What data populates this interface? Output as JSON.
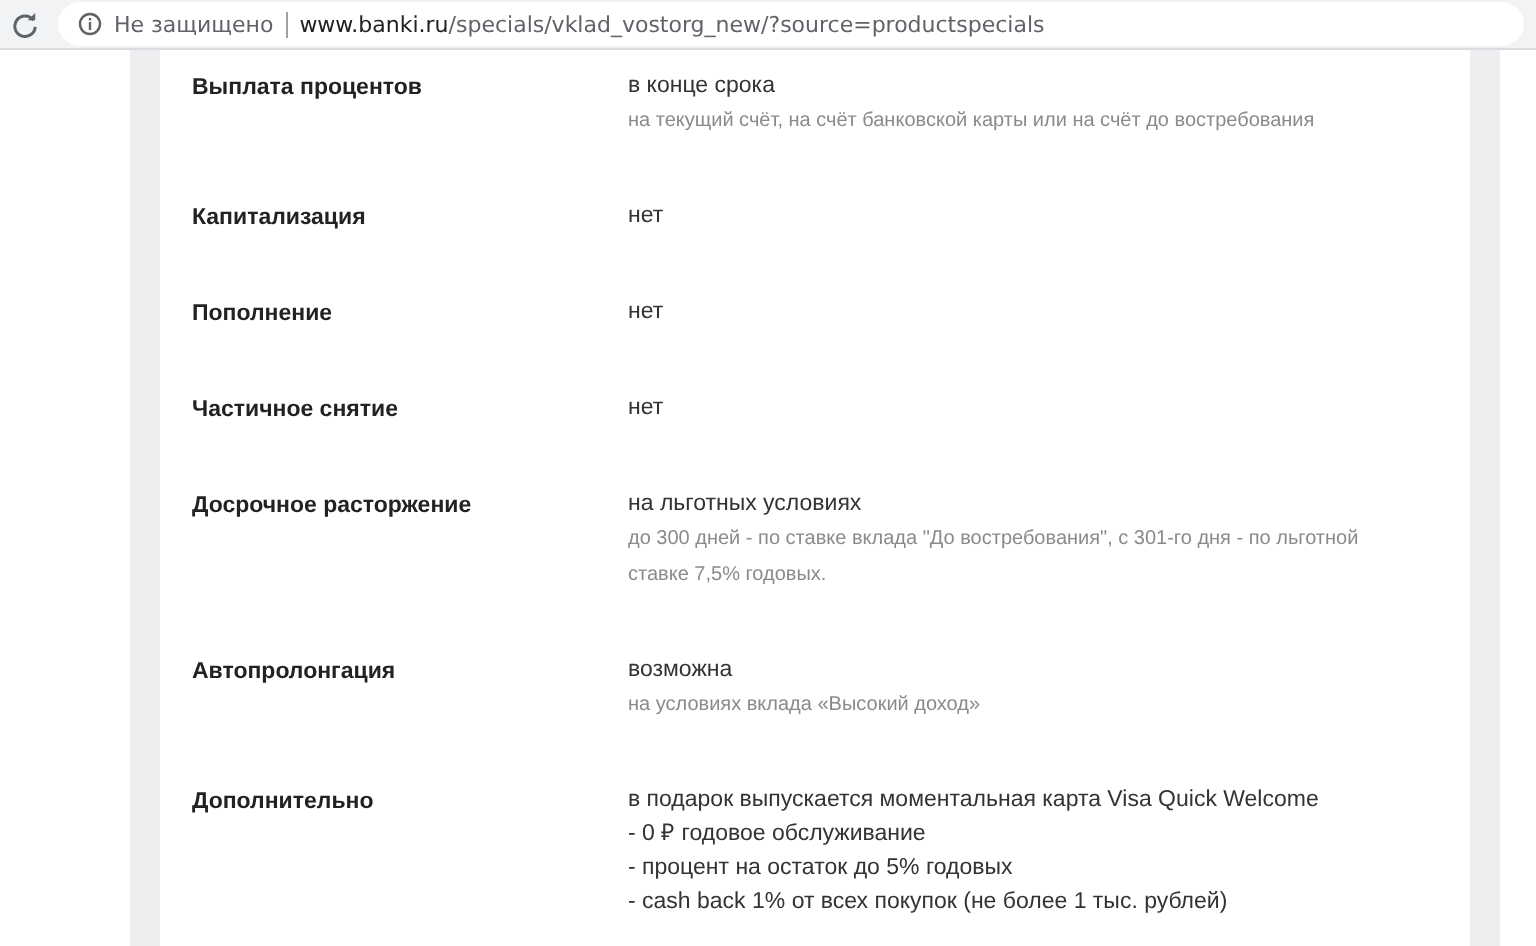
{
  "address_bar": {
    "security_label": "Не защищено",
    "url_host": "www.banki.ru",
    "url_path": "/specials/vklad_vostorg_new/?source=productspecials"
  },
  "details": [
    {
      "label": "Выплата процентов",
      "value": "в конце срока",
      "notes": [
        "на текущий счёт, на счёт банковской карты или на счёт до востребования"
      ]
    },
    {
      "label": "Капитализация",
      "value": "нет"
    },
    {
      "label": "Пополнение",
      "value": "нет"
    },
    {
      "label": "Частичное снятие",
      "value": "нет"
    },
    {
      "label": "Досрочное расторжение",
      "value": "на льготных условиях",
      "notes": [
        "до 300 дней - по ставке вклада \"До востребования\", с 301-го дня - по льготной ставке 7,5% годовых."
      ]
    },
    {
      "label": "Автопролонгация",
      "value": "возможна",
      "notes": [
        "на условиях вклада «Высокий доход»"
      ]
    },
    {
      "label": "Дополнительно",
      "value": "в подарок выпускается моментальная карта Visa Quick Welcome",
      "lines": [
        "- 0 ₽ годовое обслуживание",
        "- процент на остаток до 5% годовых",
        "- cash back 1% от всех покупок (не более 1 тыс. рублей)"
      ]
    }
  ]
}
